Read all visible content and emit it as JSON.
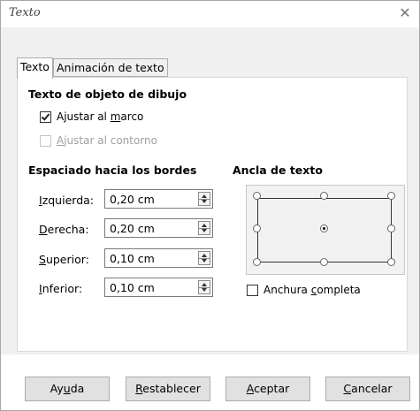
{
  "window": {
    "title": "Texto",
    "close_glyph": "✕"
  },
  "tabs": [
    {
      "label": "Texto",
      "active": true
    },
    {
      "label": "Animación de texto",
      "active": false
    }
  ],
  "drawing_object": {
    "heading": "Texto de objeto de dibujo",
    "fit_frame": {
      "pre": "Ajustar al ",
      "key": "m",
      "post": "arco",
      "checked": true,
      "enabled": true
    },
    "fit_contour": {
      "pre": "",
      "key": "A",
      "post": "justar al contorno",
      "checked": false,
      "enabled": false
    }
  },
  "spacing": {
    "heading": "Espaciado hacia los bordes",
    "fields": [
      {
        "key": "I",
        "rest": "zquierda:",
        "value": "0,20 cm"
      },
      {
        "key": "D",
        "rest": "erecha:",
        "value": "0,20 cm"
      },
      {
        "key": "S",
        "rest": "uperior:",
        "value": "0,10 cm"
      },
      {
        "key": "I",
        "rest": "nferior:",
        "value": "0,10 cm"
      }
    ]
  },
  "anchor": {
    "heading": "Ancla de texto",
    "selected": "center",
    "full_width": {
      "pre": "Anchura ",
      "key": "c",
      "post": "ompleta",
      "checked": false
    }
  },
  "buttons": {
    "help": {
      "pre": "Ay",
      "key": "u",
      "post": "da"
    },
    "reset": {
      "pre": "",
      "key": "R",
      "post": "establecer"
    },
    "ok": {
      "pre": "",
      "key": "A",
      "post": "ceptar"
    },
    "cancel": {
      "pre": "",
      "key": "C",
      "post": "ancelar"
    }
  }
}
